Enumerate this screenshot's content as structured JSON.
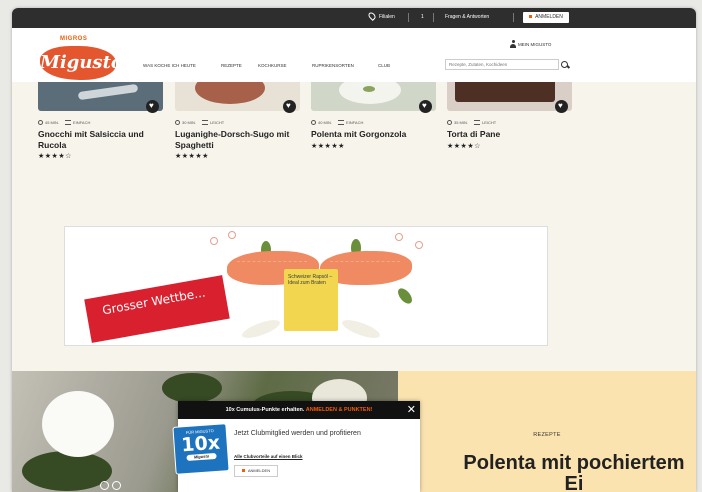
{
  "topbar": {
    "stores": "Filialen",
    "cart": "1",
    "help": "Fragen & Antworten",
    "login": "ANMELDEN"
  },
  "header": {
    "brand_small": "MIGROS",
    "logo_text": "Migusto",
    "nav": [
      "WAS KOCHE ICH HEUTE",
      "REZEPTE",
      "KOCHKURSE",
      "RUPRIKENSORTEN",
      "CLUB"
    ],
    "account_label": "MEIN MIGUSTO",
    "search_placeholder": "Rezepte, Zutaten, Kochideen"
  },
  "recipes": [
    {
      "time": "45 MIN.",
      "level": "EINFACH",
      "title": "Gnocchi mit Salsiccia und Rucola",
      "stars": "★★★★☆",
      "img_color": "#5b6d78"
    },
    {
      "time": "30 MIN.",
      "level": "LEICHT",
      "title": "Luganighe-Dorsch-Sugo mit Spaghetti",
      "stars": "★★★★★",
      "img_color": "#a7604a"
    },
    {
      "time": "40 MIN.",
      "level": "EINFACH",
      "title": "Polenta mit Gorgonzola",
      "stars": "★★★★★",
      "img_color": "#d8dccd"
    },
    {
      "time": "35 MIN.",
      "level": "LEICHT",
      "title": "Torta di Pane",
      "stars": "★★★★☆",
      "img_color": "#4e2f24"
    }
  ],
  "banner": {
    "ribbon_text": "Grosser Wettbe...",
    "package_text": "Schweizer Rapsöl – Ideal zum Braten"
  },
  "hero": {
    "label": "REZEPTE",
    "title": "Polenta mit pochiertem Ei"
  },
  "popup": {
    "header_text": "10x Cumulus-Punkte erhalten.",
    "header_highlight": "ANMELDEN & PUNKTEN!",
    "card_small": "FÜR MIGUSTO",
    "card_big": "10x",
    "card_tag": "Migusto",
    "body_text": "Jetzt Clubmitglied werden und profitieren",
    "link_text": "Alle Clubvorteile auf einen Blick",
    "button_label": "ANMELDEN"
  }
}
